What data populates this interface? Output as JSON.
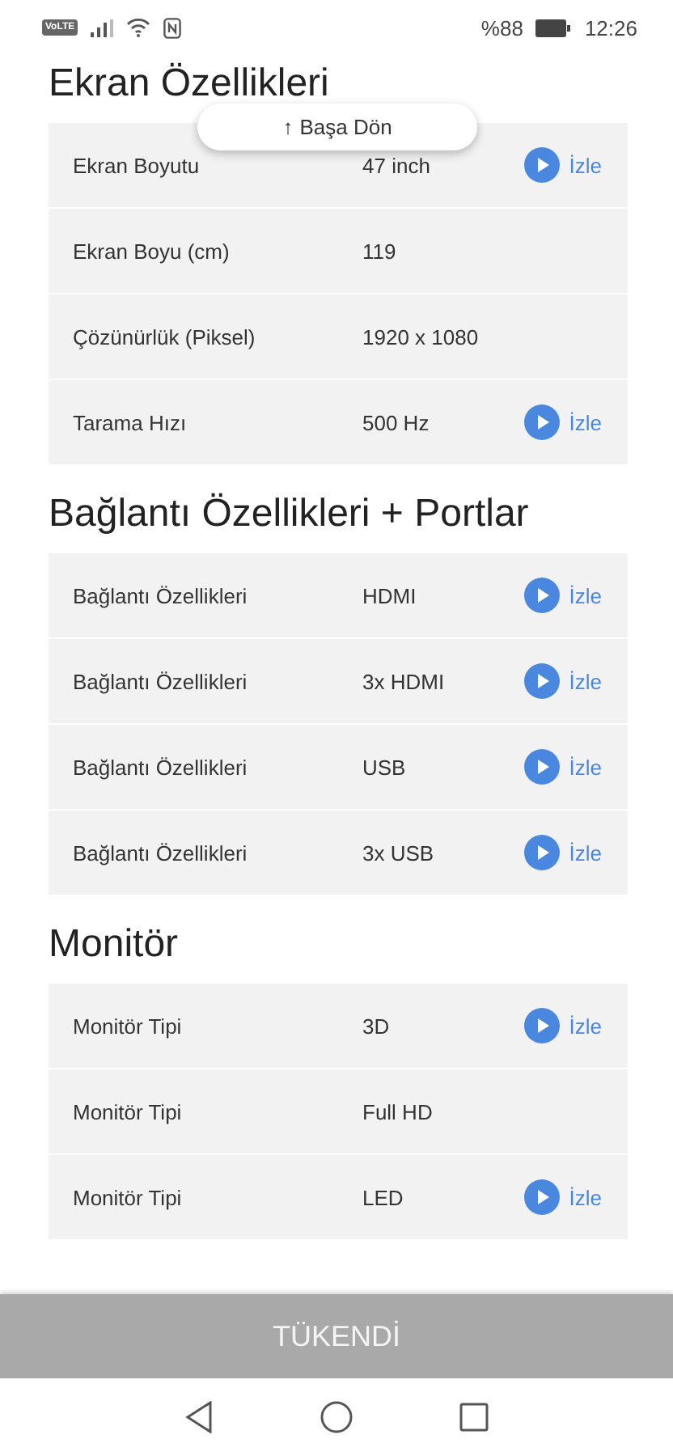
{
  "status_bar": {
    "network": "VoLTE",
    "battery": "%88",
    "time": "12:26"
  },
  "back_to_top": {
    "arrow": "↑",
    "label": "Başa Dön"
  },
  "sections": [
    {
      "title": "Ekran Özellikleri",
      "rows": [
        {
          "label": "Ekran Boyutu",
          "value": "47 inch",
          "action": "İzle"
        },
        {
          "label": "Ekran Boyu (cm)",
          "value": "119"
        },
        {
          "label": "Çözünürlük (Piksel)",
          "value": "1920 x 1080"
        },
        {
          "label": "Tarama Hızı",
          "value": "500 Hz",
          "action": "İzle"
        }
      ]
    },
    {
      "title": "Bağlantı Özellikleri + Portlar",
      "rows": [
        {
          "label": "Bağlantı Özellikleri",
          "value": "HDMI",
          "action": "İzle"
        },
        {
          "label": "Bağlantı Özellikleri",
          "value": "3x HDMI",
          "action": "İzle"
        },
        {
          "label": "Bağlantı Özellikleri",
          "value": "USB",
          "action": "İzle"
        },
        {
          "label": "Bağlantı Özellikleri",
          "value": "3x USB",
          "action": "İzle"
        }
      ]
    },
    {
      "title": "Monitör",
      "rows": [
        {
          "label": "Monitör Tipi",
          "value": "3D",
          "action": "İzle"
        },
        {
          "label": "Monitör Tipi",
          "value": "Full HD"
        },
        {
          "label": "Monitör Tipi",
          "value": "LED",
          "action": "İzle"
        }
      ]
    }
  ],
  "sold_out_button": {
    "label": "TÜKENDİ"
  }
}
